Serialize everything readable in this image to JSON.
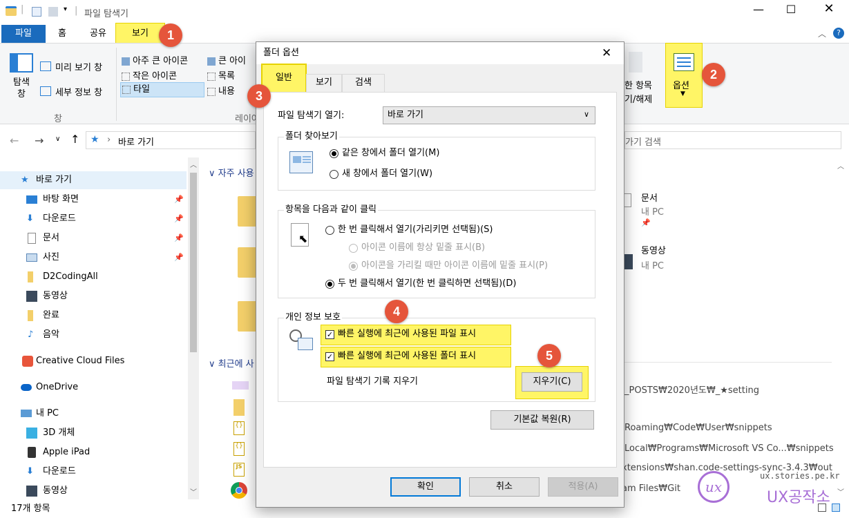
{
  "window": {
    "title": "파일 탐색기",
    "qat_separator": "|"
  },
  "ribbon_tabs": {
    "file": "파일",
    "home": "홈",
    "share": "공유",
    "view": "보기"
  },
  "ribbon": {
    "nav_pane_label": "탐색\n창",
    "preview_pane": "미리 보기 창",
    "details_pane": "세부 정보 창",
    "group_pane": "창",
    "layout_items": [
      "아주 큰 아이콘",
      "큰 아이",
      "작은 아이콘",
      "목록",
      "타일",
      "내용"
    ],
    "group_layout": "레이아",
    "hide_items": "한 항목",
    "hide_items2": "기/해제",
    "options": "옵션"
  },
  "address": {
    "path": "바로 가기",
    "search_placeholder": "가기 검색"
  },
  "nav": {
    "items": [
      {
        "label": "바로 가기",
        "icon": "star-icon",
        "pinned": false
      },
      {
        "label": "바탕 화면",
        "icon": "desktop-icon",
        "pinned": true
      },
      {
        "label": "다운로드",
        "icon": "download-icon",
        "pinned": true
      },
      {
        "label": "문서",
        "icon": "document-icon",
        "pinned": true
      },
      {
        "label": "사진",
        "icon": "picture-icon",
        "pinned": true
      },
      {
        "label": "D2CodingAll",
        "icon": "folder-icon",
        "pinned": false
      },
      {
        "label": "동영상",
        "icon": "video-icon",
        "pinned": false
      },
      {
        "label": "완료",
        "icon": "folder-icon",
        "pinned": false
      },
      {
        "label": "음악",
        "icon": "music-icon",
        "pinned": false
      },
      {
        "label": "Creative Cloud Files",
        "icon": "creative-cloud-icon",
        "pinned": false
      },
      {
        "label": "OneDrive",
        "icon": "cloud-icon",
        "pinned": false
      },
      {
        "label": "내 PC",
        "icon": "pc-icon",
        "pinned": false
      },
      {
        "label": "3D 개체",
        "icon": "cube-icon",
        "pinned": false
      },
      {
        "label": "Apple iPad",
        "icon": "ipad-icon",
        "pinned": false
      },
      {
        "label": "다운로드",
        "icon": "download-icon",
        "pinned": false
      },
      {
        "label": "동영상",
        "icon": "video-icon",
        "pinned": false
      }
    ]
  },
  "content": {
    "frequent_header": "자주 사용",
    "recent_header": "최근에 사",
    "right_items": [
      {
        "name": "문서",
        "location": "내 PC"
      },
      {
        "name": "동영상",
        "location": "내 PC"
      }
    ],
    "recent_paths": [
      "_POSTS₩2020년도₩_★setting",
      "Roaming₩Code₩User₩snippets",
      "Local₩Programs₩Microsoft VS Co...₩snippets",
      "xtensions₩shan.code-settings-sync-3.4.3₩out",
      "am Files₩Git"
    ]
  },
  "status": {
    "count": "17개 항목"
  },
  "watermark": {
    "url": "ux.stories.pe.kr",
    "name": "UX공작소"
  },
  "dialog": {
    "title": "폴더 옵션",
    "tabs": [
      "일반",
      "보기",
      "검색"
    ],
    "open_explorer_label": "파일 탐색기 열기:",
    "open_explorer_value": "바로 가기",
    "browse_group": "폴더 찾아보기",
    "browse_same": "같은 창에서 폴더 열기(M)",
    "browse_new": "새 창에서 폴더 열기(W)",
    "click_group": "항목을 다음과 같이 클릭",
    "click_single": "한 번 클릭해서 열기(가리키면 선택됨)(S)",
    "click_underline_always": "아이콘 이름에 항상 밑줄 표시(B)",
    "click_underline_hover": "아이콘을 가리킬 때만 아이콘 이름에 밑줄 표시(P)",
    "click_double": "두 번 클릭해서 열기(한 번 클릭하면 선택됨)(D)",
    "privacy_group": "개인 정보 보호",
    "privacy_files": "빠른 실행에 최근에 사용된 파일 표시",
    "privacy_folders": "빠른 실행에 최근에 사용된 폴더 표시",
    "clear_history_label": "파일 탐색기 기록 지우기",
    "clear_button": "지우기(C)",
    "restore_button": "기본값 복원(R)",
    "ok": "확인",
    "cancel": "취소",
    "apply": "적용(A)"
  },
  "badges": [
    "1",
    "2",
    "3",
    "4",
    "5"
  ],
  "colors": {
    "accent": "#0078d7",
    "highlight": "#fff566",
    "badge": "#e5553b"
  }
}
